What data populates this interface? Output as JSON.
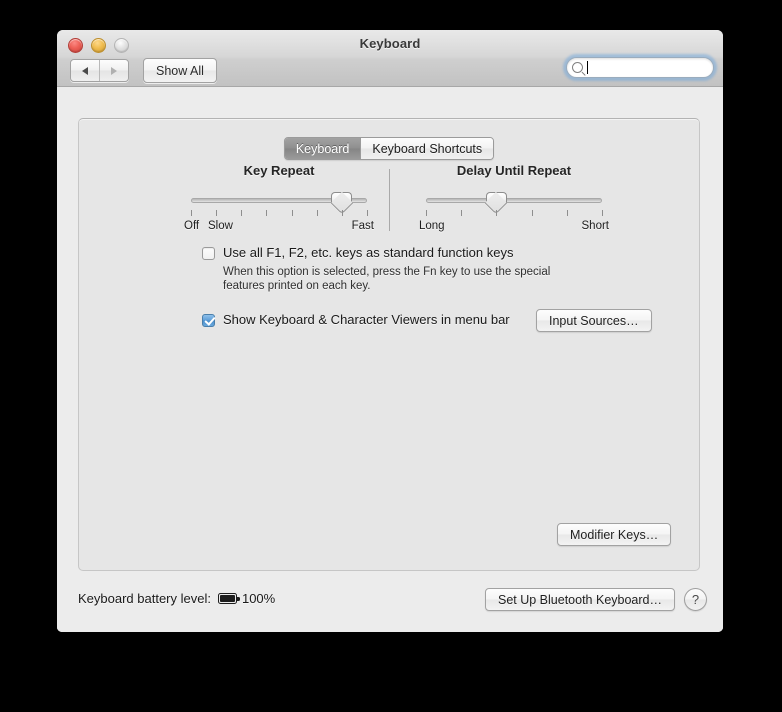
{
  "window": {
    "title": "Keyboard"
  },
  "toolbar": {
    "show_all_label": "Show All",
    "back_icon": "back-arrow-icon",
    "forward_icon": "forward-arrow-icon",
    "search": {
      "value": "",
      "placeholder": "",
      "icon": "search-icon",
      "focused": true
    }
  },
  "traffic_lights": {
    "close": "close-button",
    "minimize": "minimize-button",
    "zoom": "zoom-button"
  },
  "tabs": [
    {
      "label": "Keyboard",
      "active": true
    },
    {
      "label": "Keyboard Shortcuts",
      "active": false
    }
  ],
  "sliders": [
    {
      "title": "Key Repeat",
      "left_label": "Off",
      "second_label": "Slow",
      "right_label": "Fast",
      "ticks": 8,
      "value_index": 7
    },
    {
      "title": "Delay Until Repeat",
      "left_label": "Long",
      "right_label": "Short",
      "ticks": 6,
      "value_index": 3
    }
  ],
  "options": {
    "fn_keys": {
      "label": "Use all F1, F2, etc. keys as standard function keys",
      "checked": false,
      "help": "When this option is selected, press the Fn key to use the special features printed on each key."
    },
    "viewers": {
      "label": "Show Keyboard & Character Viewers in menu bar",
      "checked": true
    }
  },
  "buttons": {
    "input_sources": "Input Sources…",
    "modifier_keys": "Modifier Keys…",
    "setup_bluetooth": "Set Up Bluetooth Keyboard…",
    "help": "?"
  },
  "footer": {
    "battery_label": "Keyboard battery level:",
    "battery_value": "100%",
    "battery_icon": "battery-full-icon"
  },
  "colors": {
    "accent": "#5f9fd8",
    "window_bg": "#ececec",
    "panel_bg": "#e6e6e6"
  }
}
